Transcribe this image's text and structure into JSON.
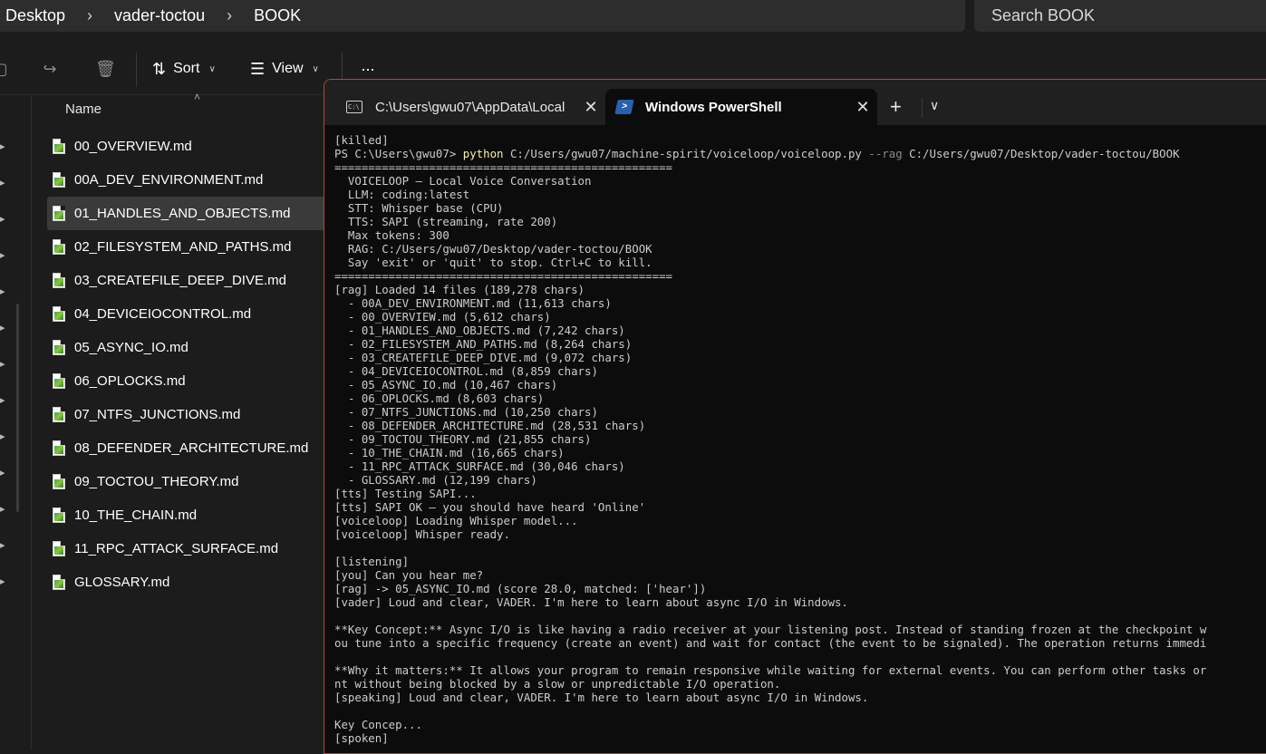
{
  "explorer": {
    "breadcrumb": [
      "Desktop",
      "vader-toctou",
      "BOOK"
    ],
    "search_placeholder": "Search BOOK",
    "toolbar": {
      "sort_label": "Sort",
      "view_label": "View",
      "more_label": "···"
    },
    "column_name": "Name",
    "files": [
      "00_OVERVIEW.md",
      "00A_DEV_ENVIRONMENT.md",
      "01_HANDLES_AND_OBJECTS.md",
      "02_FILESYSTEM_AND_PATHS.md",
      "03_CREATEFILE_DEEP_DIVE.md",
      "04_DEVICEIOCONTROL.md",
      "05_ASYNC_IO.md",
      "06_OPLOCKS.md",
      "07_NTFS_JUNCTIONS.md",
      "08_DEFENDER_ARCHITECTURE.md",
      "09_TOCTOU_THEORY.md",
      "10_THE_CHAIN.md",
      "11_RPC_ATTACK_SURFACE.md",
      "GLOSSARY.md"
    ],
    "selected_index": 2
  },
  "terminal": {
    "tabs": [
      {
        "title": "C:\\Users\\gwu07\\AppData\\Local",
        "icon": "cmd-icon"
      },
      {
        "title": "Windows PowerShell",
        "icon": "powershell-icon"
      }
    ],
    "new_tab_label": "+",
    "dropdown_label": "⌄",
    "prompt": {
      "prefix": "PS C:\\Users\\gwu07> ",
      "command": "python",
      "arg1": " C:/Users/gwu07/machine-spirit/voiceloop/voiceloop.py ",
      "flag": "--rag",
      "arg2": " C:/Users/gwu07/Desktop/vader-toctou/BOOK"
    },
    "first_line": "[killed]",
    "lines_after": [
      "==================================================",
      "  VOICELOOP — Local Voice Conversation",
      "  LLM: coding:latest",
      "  STT: Whisper base (CPU)",
      "  TTS: SAPI (streaming, rate 200)",
      "  Max tokens: 300",
      "  RAG: C:/Users/gwu07/Desktop/vader-toctou/BOOK",
      "  Say 'exit' or 'quit' to stop. Ctrl+C to kill.",
      "==================================================",
      "[rag] Loaded 14 files (189,278 chars)",
      "  - 00A_DEV_ENVIRONMENT.md (11,613 chars)",
      "  - 00_OVERVIEW.md (5,612 chars)",
      "  - 01_HANDLES_AND_OBJECTS.md (7,242 chars)",
      "  - 02_FILESYSTEM_AND_PATHS.md (8,264 chars)",
      "  - 03_CREATEFILE_DEEP_DIVE.md (9,072 chars)",
      "  - 04_DEVICEIOCONTROL.md (8,859 chars)",
      "  - 05_ASYNC_IO.md (10,467 chars)",
      "  - 06_OPLOCKS.md (8,603 chars)",
      "  - 07_NTFS_JUNCTIONS.md (10,250 chars)",
      "  - 08_DEFENDER_ARCHITECTURE.md (28,531 chars)",
      "  - 09_TOCTOU_THEORY.md (21,855 chars)",
      "  - 10_THE_CHAIN.md (16,665 chars)",
      "  - 11_RPC_ATTACK_SURFACE.md (30,046 chars)",
      "  - GLOSSARY.md (12,199 chars)",
      "[tts] Testing SAPI...",
      "[tts] SAPI OK — you should have heard 'Online'",
      "[voiceloop] Loading Whisper model...",
      "[voiceloop] Whisper ready.",
      "",
      "[listening]",
      "[you] Can you hear me?",
      "[rag] -> 05_ASYNC_IO.md (score 28.0, matched: ['hear'])",
      "[vader] Loud and clear, VADER. I'm here to learn about async I/O in Windows.",
      "",
      "**Key Concept:** Async I/O is like having a radio receiver at your listening post. Instead of standing frozen at the checkpoint w",
      "ou tune into a specific frequency (create an event) and wait for contact (the event to be signaled). The operation returns immedi",
      "",
      "**Why it matters:** It allows your program to remain responsive while waiting for external events. You can perform other tasks or",
      "nt without being blocked by a slow or unpredictable I/O operation.",
      "[speaking] Loud and clear, VADER. I'm here to learn about async I/O in Windows.",
      "",
      "Key Concep...",
      "[spoken]"
    ]
  }
}
